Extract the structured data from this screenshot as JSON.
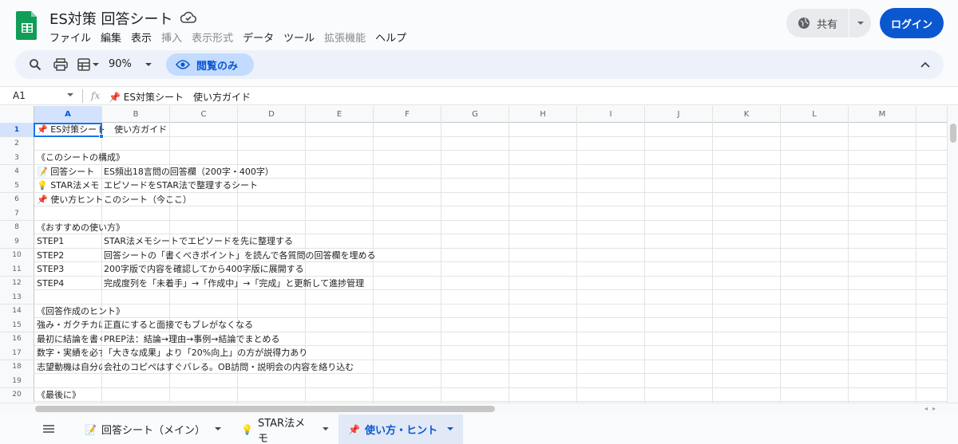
{
  "header": {
    "doc_title": "ES対策 回答シート",
    "menu": [
      "ファイル",
      "編集",
      "表示",
      "挿入",
      "表示形式",
      "データ",
      "ツール",
      "拡張機能",
      "ヘルプ"
    ],
    "menu_disabled": [
      false,
      false,
      false,
      true,
      true,
      false,
      false,
      true,
      false
    ],
    "share_label": "共有",
    "login_label": "ログイン"
  },
  "toolbar": {
    "zoom": "90%",
    "view_only_label": "閲覧のみ"
  },
  "formula_bar": {
    "cell_ref": "A1",
    "fx": "fx",
    "content": "📌 ES対策シート　使い方ガイド"
  },
  "columns": [
    "A",
    "B",
    "C",
    "D",
    "E",
    "F",
    "G",
    "H",
    "I",
    "J",
    "K",
    "L",
    "M"
  ],
  "active_column": "A",
  "rows": [
    {
      "n": "1",
      "a": "📌 ES対策シート　使い方ガイド",
      "b": ""
    },
    {
      "n": "2",
      "a": "",
      "b": ""
    },
    {
      "n": "3",
      "a": "《このシートの構成》",
      "b": ""
    },
    {
      "n": "4",
      "a": "📝 回答シート",
      "b": "ES頻出18言問の回答欄（200字・400字）"
    },
    {
      "n": "5",
      "a": "💡 STAR法メモ",
      "b": "エピソードをSTAR法で整理するシート"
    },
    {
      "n": "6",
      "a": "📌 使い方ヒント",
      "b": "このシート（今ここ）"
    },
    {
      "n": "7",
      "a": "",
      "b": ""
    },
    {
      "n": "8",
      "a": "《おすすめの使い方》",
      "b": ""
    },
    {
      "n": "9",
      "a": "STEP1",
      "b": "STAR法メモシートでエピソードを先に整理する"
    },
    {
      "n": "10",
      "a": "STEP2",
      "b": "回答シートの「書くべきポイント」を読んで各質問の回答欄を埋める"
    },
    {
      "n": "11",
      "a": "STEP3",
      "b": "200字版で内容を確認してから400字版に展開する"
    },
    {
      "n": "12",
      "a": "STEP4",
      "b": "完成度列を「未着手」→「作成中」→「完成」と更新して進捗管理"
    },
    {
      "n": "13",
      "a": "",
      "b": ""
    },
    {
      "n": "14",
      "a": "《回答作成のヒント》",
      "b": ""
    },
    {
      "n": "15",
      "a": "強み・ガクチカは",
      "b": "正直にすると面接でもブレがなくなる"
    },
    {
      "n": "16",
      "a": "最初に結論を書く",
      "b": "PREP法：結論→理由→事例→結論でまとめる"
    },
    {
      "n": "17",
      "a": "数字・実績を必ず",
      "b": "「大きな成果」より「20%向上」の方が説得力あり"
    },
    {
      "n": "18",
      "a": "志望動機は自分の",
      "b": "会社のコピペはすぐバレる。OB訪問・説明会の内容を絡り込む"
    },
    {
      "n": "19",
      "a": "",
      "b": ""
    },
    {
      "n": "20",
      "a": "《最後に》",
      "b": ""
    }
  ],
  "sheet_tabs": [
    {
      "emoji": "📝",
      "label": "回答シート（メイン）",
      "active": false
    },
    {
      "emoji": "💡",
      "label": "STAR法メモ",
      "active": false
    },
    {
      "emoji": "📌",
      "label": "使い方・ヒント",
      "active": true
    }
  ],
  "colors": {
    "accent": "#0b57d0",
    "logo_green": "#0f9d58",
    "selection": "#1a73e8",
    "view_only_bg": "#c2dbff"
  }
}
